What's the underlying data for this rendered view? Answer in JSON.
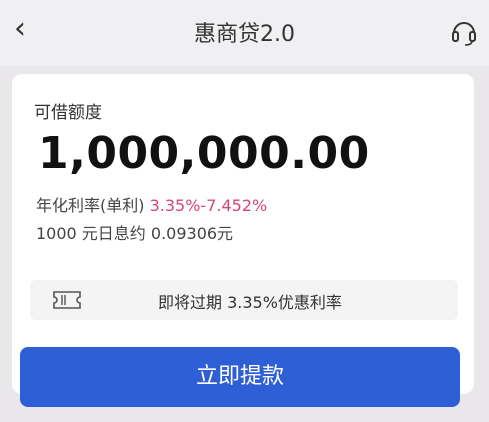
{
  "nav": {
    "title": "惠商贷2.0",
    "back_icon": "chevron-left-icon",
    "support_icon": "headset-icon"
  },
  "loan": {
    "quota_label": "可借额度",
    "amount": "1,000,000.00",
    "rate_label": "年化利率(单利)",
    "rate_value": "3.35%-7.452%",
    "daily_interest": "1000 元日息约 0.09306元"
  },
  "promo": {
    "icon": "ticket-icon",
    "text": "即将过期 3.35%优惠利率"
  },
  "cta": {
    "label": "立即提款"
  },
  "colors": {
    "accent": "#2f5fd6",
    "rate_highlight": "#d4477a"
  }
}
